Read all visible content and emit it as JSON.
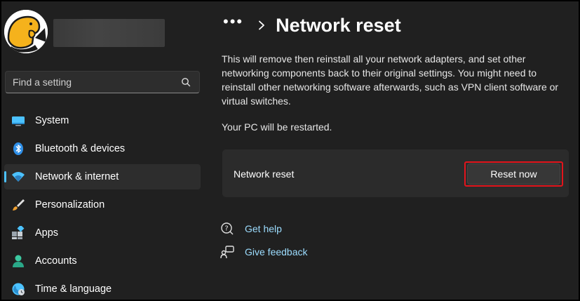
{
  "sidebar": {
    "search_placeholder": "Find a setting",
    "items": [
      {
        "label": "System",
        "icon": "monitor-icon",
        "active": false
      },
      {
        "label": "Bluetooth & devices",
        "icon": "bluetooth-icon",
        "active": false
      },
      {
        "label": "Network & internet",
        "icon": "wifi-icon",
        "active": true
      },
      {
        "label": "Personalization",
        "icon": "brush-icon",
        "active": false
      },
      {
        "label": "Apps",
        "icon": "apps-icon",
        "active": false
      },
      {
        "label": "Accounts",
        "icon": "person-icon",
        "active": false
      },
      {
        "label": "Time & language",
        "icon": "globe-icon",
        "active": false
      }
    ]
  },
  "header": {
    "breadcrumb_more": "•••",
    "title": "Network reset"
  },
  "main": {
    "description": "This will remove then reinstall all your network adapters, and set other networking components back to their original settings. You might need to reinstall other networking software afterwards, such as VPN client software or virtual switches.",
    "restart_note": "Your PC will be restarted.",
    "card": {
      "label": "Network reset",
      "button_label": "Reset now"
    },
    "links": [
      {
        "label": "Get help",
        "icon": "help-icon"
      },
      {
        "label": "Give feedback",
        "icon": "feedback-icon"
      }
    ]
  },
  "colors": {
    "background": "#202020",
    "accent": "#4cc2ff",
    "link": "#9cdcfe",
    "highlight": "#e3141c"
  }
}
